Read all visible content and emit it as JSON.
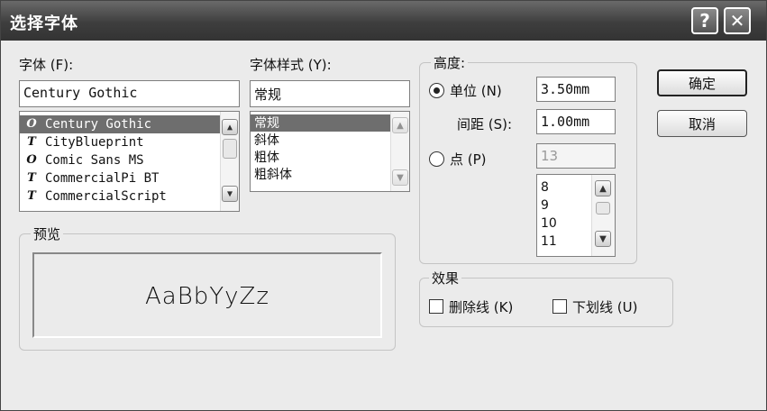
{
  "window": {
    "title": "选择字体",
    "help_glyph": "?",
    "close_glyph": "✕"
  },
  "font": {
    "label": "字体 (F):",
    "value": "Century Gothic",
    "items": [
      {
        "name": "Century Gothic",
        "icon": "O",
        "selected": true
      },
      {
        "name": "CityBlueprint",
        "icon": "T",
        "selected": false
      },
      {
        "name": "Comic Sans MS",
        "icon": "O",
        "selected": false
      },
      {
        "name": "CommercialPi BT",
        "icon": "T",
        "selected": false
      },
      {
        "name": "CommercialScript",
        "icon": "T",
        "selected": false
      }
    ]
  },
  "style": {
    "label": "字体样式 (Y):",
    "value": "常规",
    "items": [
      {
        "name": "常规",
        "selected": true
      },
      {
        "name": "斜体",
        "selected": false
      },
      {
        "name": "粗体",
        "selected": false
      },
      {
        "name": "粗斜体",
        "selected": false
      }
    ]
  },
  "height": {
    "group_label": "高度:",
    "unit_label": "单位 (N)",
    "unit_value": "3.50mm",
    "spacing_label": "间距 (S):",
    "spacing_value": "1.00mm",
    "point_label": "点 (P)",
    "point_value": "13",
    "point_items": [
      "8",
      "9",
      "10",
      "11"
    ],
    "selected_mode": "unit"
  },
  "effects": {
    "group_label": "效果",
    "strike_label": "删除线 (K)",
    "underline_label": "下划线 (U)",
    "strike_checked": false,
    "underline_checked": false
  },
  "preview": {
    "group_label": "预览",
    "sample": "AaBbYyZz"
  },
  "buttons": {
    "ok": "确定",
    "cancel": "取消"
  },
  "scroll_glyphs": {
    "up": "▲",
    "down": "▼"
  }
}
